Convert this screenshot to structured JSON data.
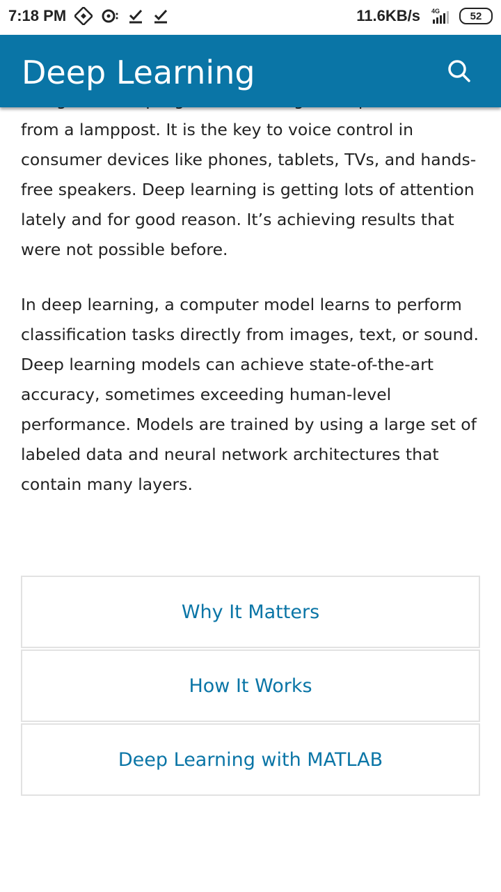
{
  "status_bar": {
    "time": "7:18 PM",
    "network_speed": "11.6KB/s",
    "network_type": "4G",
    "battery_level": "52",
    "icons": [
      "compass-icon",
      "sync-icon",
      "download-done-icon",
      "download-done-icon",
      "signal-icon",
      "battery-icon"
    ]
  },
  "header": {
    "title": "Deep Learning",
    "search_icon": "search-icon",
    "background_color": "#0a75a6",
    "title_color": "#ffffff"
  },
  "content": {
    "paragraphs": [
      "recognize a stop sign, or to distinguish a pedestrian from a lamppost. It is the key to voice control in consumer devices like phones, tablets, TVs, and hands-free speakers. Deep learning is getting lots of attention lately and for good reason. It’s achieving results that were not possible before.",
      "In deep learning, a computer model learns to perform classification tasks directly from images, text, or sound. Deep learning models can achieve state-of-the-art accuracy, sometimes exceeding human-level performance. Models are trained by using a large set of labeled data and neural network architectures that contain many layers."
    ],
    "text_color": "#222222"
  },
  "nav_cards": [
    {
      "label": "Why It Matters"
    },
    {
      "label": "How It Works"
    },
    {
      "label": "Deep Learning with MATLAB"
    }
  ],
  "link_color": "#0a75a6"
}
